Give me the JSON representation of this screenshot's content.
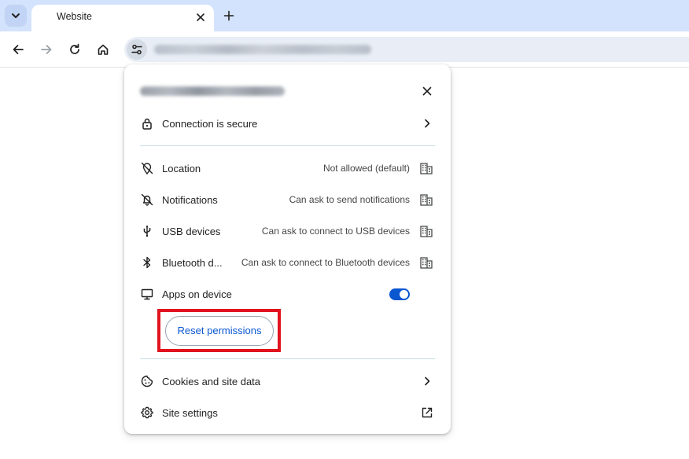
{
  "browser": {
    "tab_title": "Website"
  },
  "popup": {
    "connection_label": "Connection is secure",
    "permissions": [
      {
        "label": "Location",
        "value": "Not allowed (default)"
      },
      {
        "label": "Notifications",
        "value": "Can ask to send notifications"
      },
      {
        "label": "USB devices",
        "value": "Can ask to connect to USB devices"
      },
      {
        "label": "Bluetooth d...",
        "value": "Can ask to connect to Bluetooth devices"
      }
    ],
    "apps_label": "Apps on device",
    "apps_toggle_on": true,
    "reset_label": "Reset permissions",
    "cookies_label": "Cookies and site data",
    "site_settings_label": "Site settings"
  },
  "icons": {
    "tab_search": "chevron-down-icon",
    "tab_close": "close-icon",
    "new_tab": "plus-icon",
    "back": "arrow-left-icon",
    "forward": "arrow-right-icon",
    "reload": "reload-icon",
    "home": "home-icon",
    "site_info": "tune-icon",
    "lock": "lock-icon",
    "location_off": "location-off-icon",
    "notifications_off": "notifications-off-icon",
    "usb": "usb-icon",
    "bluetooth": "bluetooth-icon",
    "monitor": "monitor-icon",
    "cookie": "cookie-icon",
    "gear": "gear-icon",
    "open_external": "open-in-new-icon",
    "managed": "building-icon"
  },
  "colors": {
    "tabstrip": "#d3e3fd",
    "accent": "#0b57d0",
    "annotation": "#e1131e"
  }
}
